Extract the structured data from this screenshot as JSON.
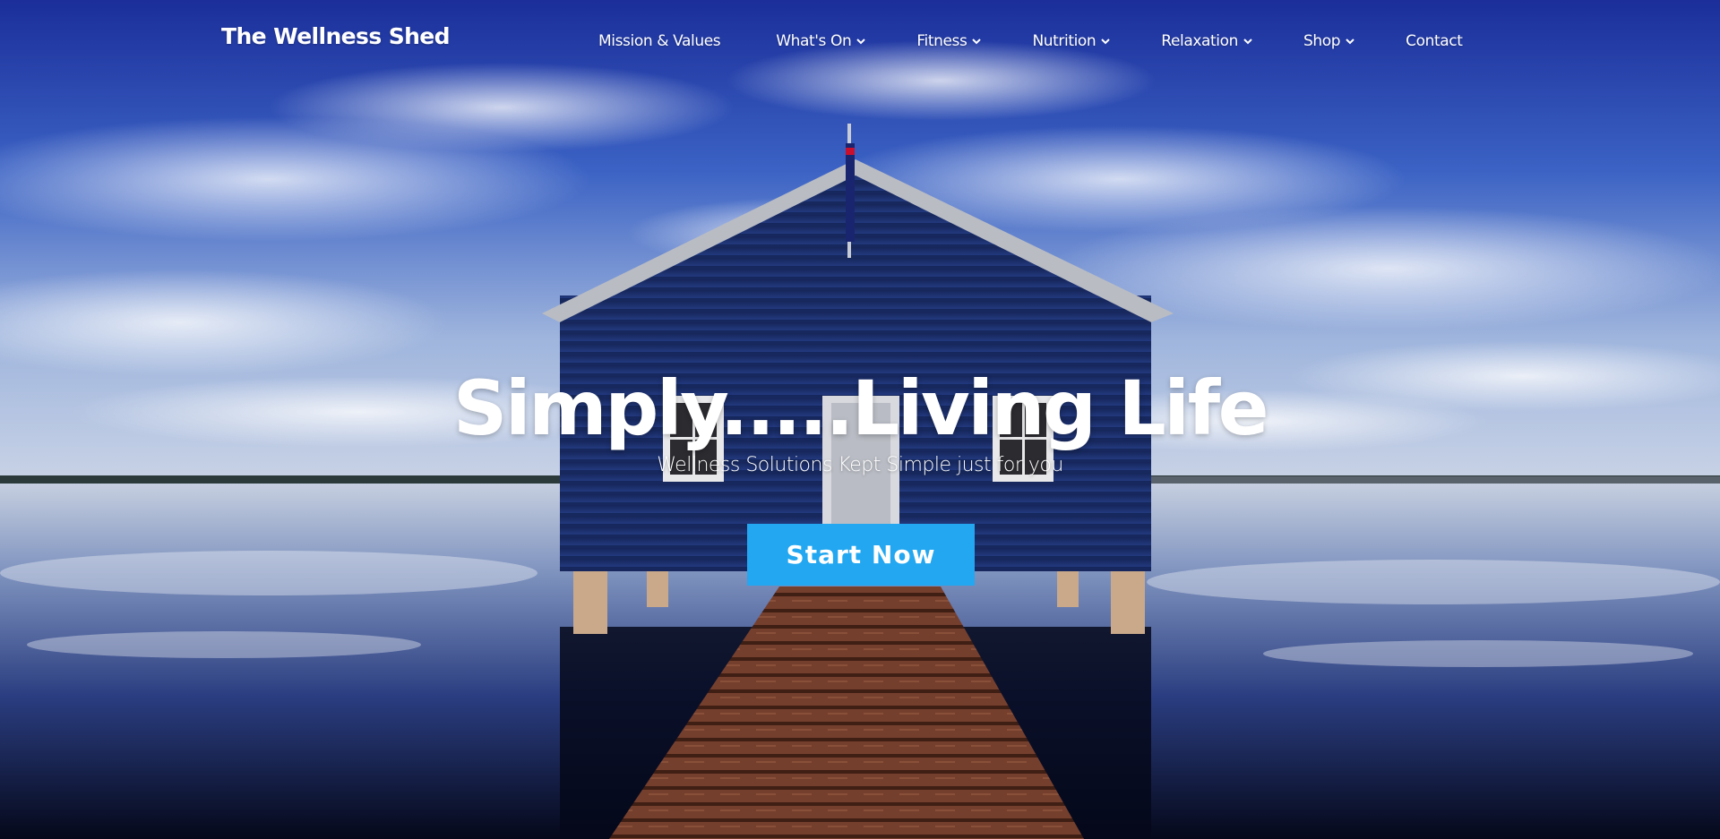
{
  "site": {
    "logo_text": "The Wellness Shed"
  },
  "nav": {
    "items": [
      {
        "label": "Mission & Values",
        "has_dropdown": false
      },
      {
        "label": "What's On",
        "has_dropdown": true
      },
      {
        "label": "Fitness",
        "has_dropdown": true
      },
      {
        "label": "Nutrition",
        "has_dropdown": true
      },
      {
        "label": "Relaxation",
        "has_dropdown": true
      },
      {
        "label": "Shop",
        "has_dropdown": true
      },
      {
        "label": "Contact",
        "has_dropdown": false
      }
    ],
    "dropdown_icon": "chevron-down-icon"
  },
  "hero": {
    "title": "Simply.....Living Life",
    "subtitle": "Wellness Solutions Kept Simple just for you",
    "cta_label": "Start Now",
    "background_image": "blue boathouse on a jetty over a lake under a cloudy blue sky"
  },
  "colors": {
    "accent": "#22a7f0",
    "text": "#ffffff",
    "sky": "#2d4fb8",
    "boathouse": "#1f3472",
    "jetty": "#8a4a35"
  }
}
